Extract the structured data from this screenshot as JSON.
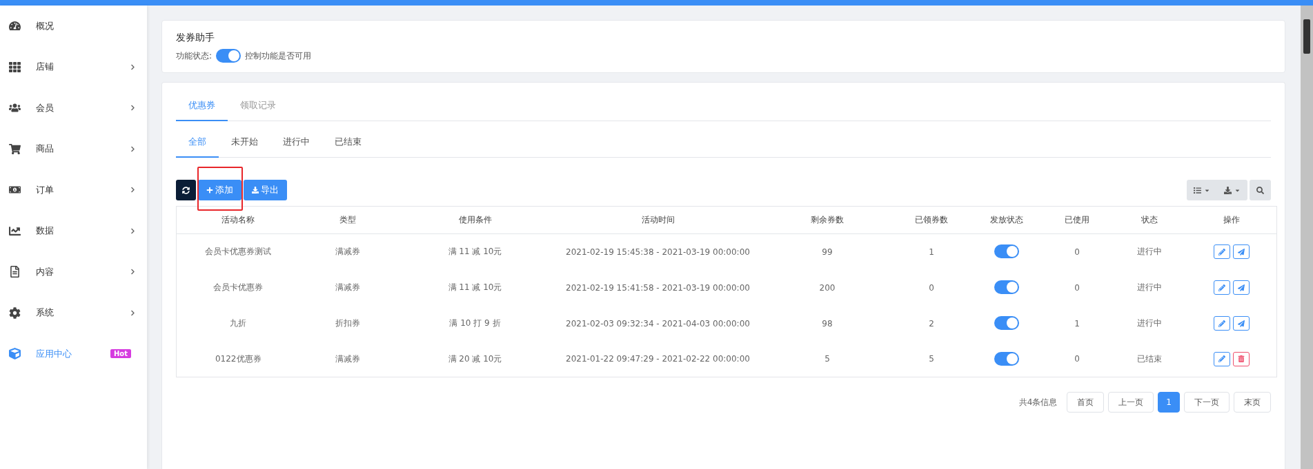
{
  "sidebar": {
    "items": [
      {
        "label": "概况",
        "selected": false,
        "submenu": false
      },
      {
        "label": "店铺",
        "selected": false,
        "submenu": true
      },
      {
        "label": "会员",
        "selected": false,
        "submenu": true
      },
      {
        "label": "商品",
        "selected": false,
        "submenu": true
      },
      {
        "label": "订单",
        "selected": false,
        "submenu": true
      },
      {
        "label": "数据",
        "selected": false,
        "submenu": true
      },
      {
        "label": "内容",
        "selected": false,
        "submenu": true
      },
      {
        "label": "系统",
        "selected": false,
        "submenu": true
      },
      {
        "label": "应用中心",
        "selected": true,
        "submenu": false,
        "badge": "Hot"
      }
    ]
  },
  "header_card": {
    "title": "发券助手",
    "status_label": "功能状态:",
    "status_on": true,
    "hint": "控制功能是否可用"
  },
  "tabs": [
    {
      "label": "优惠券",
      "selected": true
    },
    {
      "label": "领取记录",
      "selected": false
    }
  ],
  "sub_tabs": [
    {
      "label": "全部",
      "selected": true
    },
    {
      "label": "未开始",
      "selected": false
    },
    {
      "label": "进行中",
      "selected": false
    },
    {
      "label": "已结束",
      "selected": false
    }
  ],
  "toolbar": {
    "add_label": "添加",
    "export_label": "导出",
    "highlight_add": true
  },
  "table": {
    "columns": [
      "活动名称",
      "类型",
      "使用条件",
      "活动时间",
      "剩余券数",
      "已领券数",
      "发放状态",
      "已使用",
      "状态",
      "操作"
    ],
    "rows": [
      {
        "name": "会员卡优惠券测试",
        "type": "满减券",
        "condition": "满 11 减 10元",
        "time": "2021-02-19 15:45:38 - 2021-03-19 00:00:00",
        "remaining": "99",
        "claimed": "1",
        "issuing": true,
        "used": "0",
        "status": "进行中",
        "actions": [
          {
            "kind": "edit"
          },
          {
            "kind": "send"
          }
        ]
      },
      {
        "name": "会员卡优惠券",
        "type": "满减券",
        "condition": "满 11 减 10元",
        "time": "2021-02-19 15:41:58 - 2021-03-19 00:00:00",
        "remaining": "200",
        "claimed": "0",
        "issuing": true,
        "used": "0",
        "status": "进行中",
        "actions": [
          {
            "kind": "edit"
          },
          {
            "kind": "send"
          }
        ]
      },
      {
        "name": "九折",
        "type": "折扣券",
        "condition": "满 10 打 9 折",
        "time": "2021-02-03 09:32:34 - 2021-04-03 00:00:00",
        "remaining": "98",
        "claimed": "2",
        "issuing": true,
        "used": "1",
        "status": "进行中",
        "actions": [
          {
            "kind": "edit"
          },
          {
            "kind": "send"
          }
        ]
      },
      {
        "name": "0122优惠券",
        "type": "满减券",
        "condition": "满 20 减 10元",
        "time": "2021-01-22 09:47:29 - 2021-02-22 00:00:00",
        "remaining": "5",
        "claimed": "5",
        "issuing": true,
        "used": "0",
        "status": "已结束",
        "actions": [
          {
            "kind": "edit"
          },
          {
            "kind": "delete"
          }
        ]
      }
    ]
  },
  "pagination": {
    "summary": "共4条信息",
    "first": "首页",
    "prev": "上一页",
    "pages": [
      {
        "label": "1",
        "selected": true
      }
    ],
    "next": "下一页",
    "last": "末页"
  }
}
